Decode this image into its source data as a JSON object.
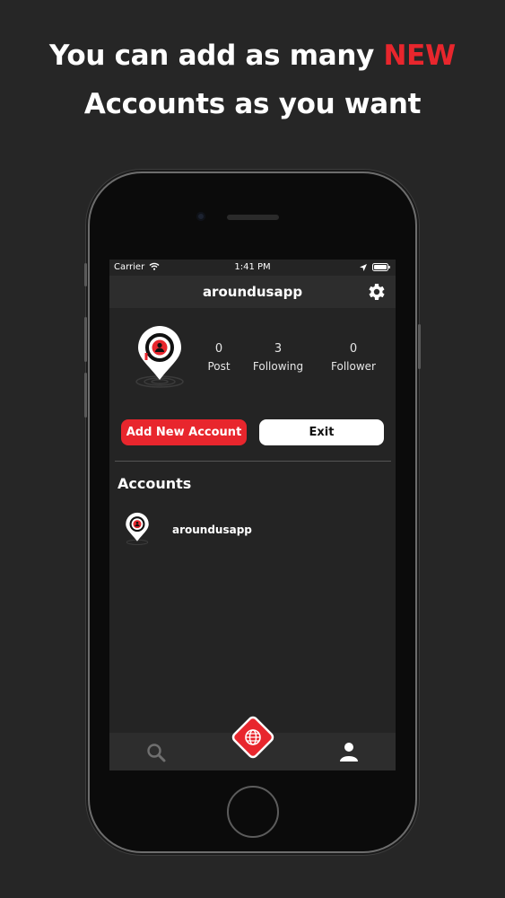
{
  "promo": {
    "line1_prefix": "You can add as many ",
    "line1_highlight": "NEW",
    "line2": "Accounts as you want"
  },
  "status_bar": {
    "carrier": "Carrier",
    "time": "1:41 PM"
  },
  "nav": {
    "title": "aroundusapp",
    "settings_icon": "gear-icon"
  },
  "profile": {
    "stats": [
      {
        "value": "0",
        "label": "Post"
      },
      {
        "value": "3",
        "label": "Following"
      },
      {
        "value": "0",
        "label": "Follower"
      }
    ]
  },
  "actions": {
    "add_label": "Add New Account",
    "exit_label": "Exit"
  },
  "accounts": {
    "heading": "Accounts",
    "items": [
      {
        "name": "aroundusapp"
      }
    ]
  },
  "tabbar": {
    "icons": [
      "search-icon",
      "globe-icon",
      "person-icon"
    ]
  },
  "colors": {
    "accent": "#e8262d",
    "background": "#242424",
    "bar": "#2d2d2d"
  }
}
